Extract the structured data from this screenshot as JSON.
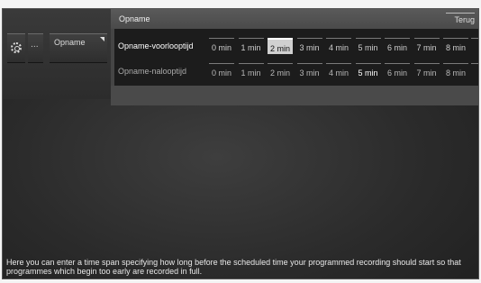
{
  "breadcrumb": {
    "gear_icon": "gear-icon",
    "more_label": "...",
    "opname_label": "Opname"
  },
  "menu": {
    "title": "Opname",
    "back_label": "Terug",
    "rows": [
      {
        "label": "Opname-voorlooptijd",
        "options": [
          "0 min",
          "1 min",
          "2 min",
          "3 min",
          "4 min",
          "5 min",
          "6 min",
          "7 min",
          "8 min"
        ],
        "selected": "2 min"
      },
      {
        "label": "Opname-nalooptijd",
        "options": [
          "0 min",
          "1 min",
          "2 min",
          "3 min",
          "4 min",
          "5 min",
          "6 min",
          "7 min",
          "8 min"
        ],
        "selected": "5 min"
      }
    ]
  },
  "help_text": "Here you can enter a time span specifying how long before the scheduled time your programmed recording should start so that programmes which begin too early are recorded in full."
}
